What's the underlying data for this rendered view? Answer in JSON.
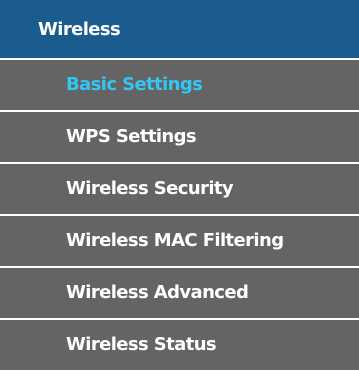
{
  "menu": {
    "header_label": "Wireless",
    "active_color": "#33c6f2",
    "header_color": "#1a5c8e",
    "item_color": "#646464",
    "items": [
      {
        "label": "Basic Settings",
        "active": true
      },
      {
        "label": "WPS Settings",
        "active": false
      },
      {
        "label": "Wireless Security",
        "active": false
      },
      {
        "label": "Wireless MAC Filtering",
        "active": false
      },
      {
        "label": "Wireless Advanced",
        "active": false
      },
      {
        "label": "Wireless Status",
        "active": false
      }
    ]
  }
}
